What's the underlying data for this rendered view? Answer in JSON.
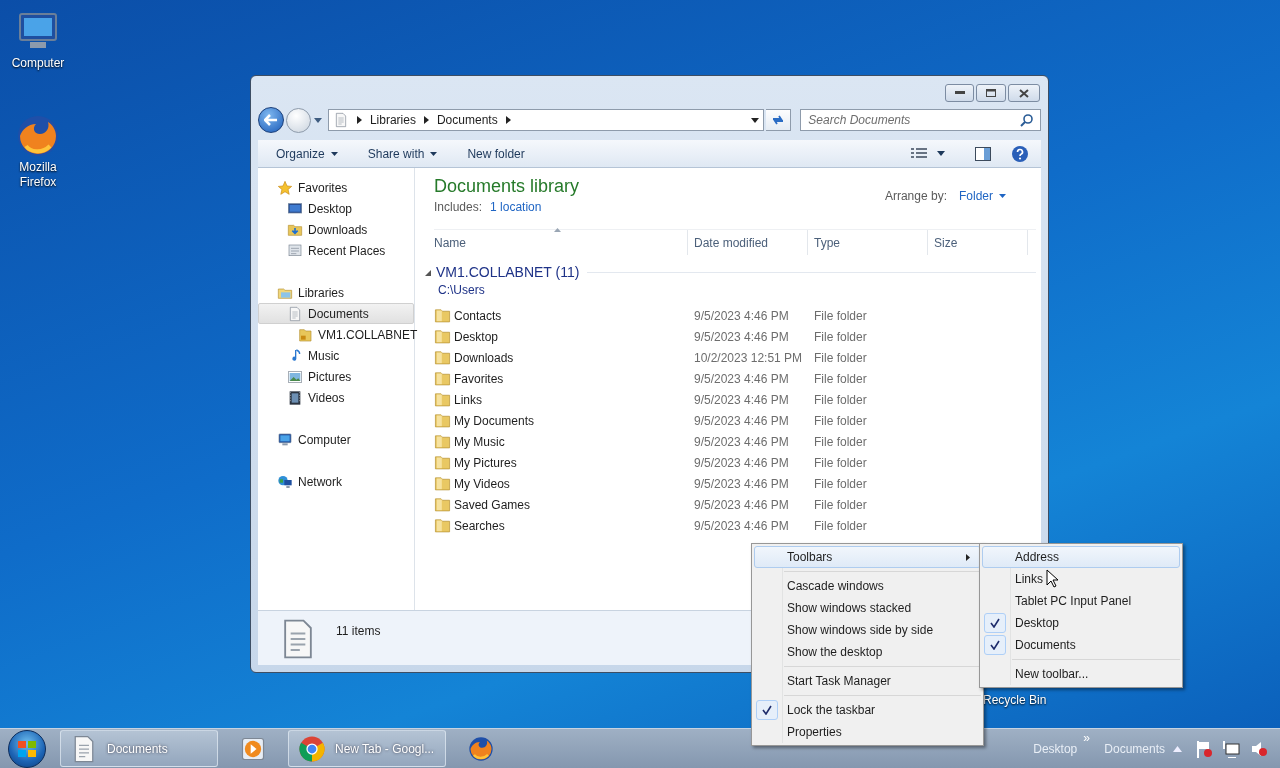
{
  "desktop": {
    "icons": [
      {
        "label": "Computer",
        "kind": "computer"
      },
      {
        "label": "Mozilla Firefox",
        "kind": "firefox"
      }
    ],
    "recycle_bin_label": "Recycle Bin"
  },
  "explorer": {
    "breadcrumb": [
      "Libraries",
      "Documents"
    ],
    "search": {
      "placeholder": "Search Documents"
    },
    "toolbar": [
      {
        "label": "Organize",
        "dropdown": true
      },
      {
        "label": "Share with",
        "dropdown": true
      },
      {
        "label": "New folder",
        "dropdown": false
      }
    ],
    "nav": [
      {
        "label": "Favorites",
        "kind": "star",
        "selected": false,
        "children": [
          {
            "label": "Desktop",
            "kind": "desktop",
            "selected": false
          },
          {
            "label": "Downloads",
            "kind": "downloads",
            "selected": false
          },
          {
            "label": "Recent Places",
            "kind": "recent",
            "selected": false
          }
        ]
      },
      {
        "label": "Libraries",
        "kind": "libraries",
        "selected": false,
        "children": [
          {
            "label": "Documents",
            "kind": "document",
            "selected": true,
            "children": [
              {
                "label": "VM1.COLLABNET",
                "kind": "lockfolder",
                "selected": false
              }
            ]
          },
          {
            "label": "Music",
            "kind": "music",
            "selected": false
          },
          {
            "label": "Pictures",
            "kind": "pictures",
            "selected": false
          },
          {
            "label": "Videos",
            "kind": "videos",
            "selected": false
          }
        ]
      },
      {
        "label": "Computer",
        "kind": "computer",
        "selected": false
      },
      {
        "label": "Network",
        "kind": "network",
        "selected": false
      }
    ],
    "library": {
      "title": "Documents library",
      "includes_label": "Includes:",
      "includes_link": "1 location",
      "arrange_label": "Arrange by:",
      "arrange_value": "Folder"
    },
    "columns": [
      "Name",
      "Date modified",
      "Type",
      "Size"
    ],
    "group": {
      "title": "VM1.COLLABNET (11)",
      "path": "C:\\Users",
      "expanded": true
    },
    "rows": [
      {
        "name": "Contacts",
        "date": "9/5/2023 4:46 PM",
        "type": "File folder"
      },
      {
        "name": "Desktop",
        "date": "9/5/2023 4:46 PM",
        "type": "File folder"
      },
      {
        "name": "Downloads",
        "date": "10/2/2023 12:51 PM",
        "type": "File folder"
      },
      {
        "name": "Favorites",
        "date": "9/5/2023 4:46 PM",
        "type": "File folder"
      },
      {
        "name": "Links",
        "date": "9/5/2023 4:46 PM",
        "type": "File folder"
      },
      {
        "name": "My Documents",
        "date": "9/5/2023 4:46 PM",
        "type": "File folder"
      },
      {
        "name": "My Music",
        "date": "9/5/2023 4:46 PM",
        "type": "File folder"
      },
      {
        "name": "My Pictures",
        "date": "9/5/2023 4:46 PM",
        "type": "File folder"
      },
      {
        "name": "My Videos",
        "date": "9/5/2023 4:46 PM",
        "type": "File folder"
      },
      {
        "name": "Saved Games",
        "date": "9/5/2023 4:46 PM",
        "type": "File folder"
      },
      {
        "name": "Searches",
        "date": "9/5/2023 4:46 PM",
        "type": "File folder"
      }
    ],
    "status": "11 items"
  },
  "context_menu": {
    "items": [
      {
        "kind": "item",
        "label": "Toolbars",
        "submenu": true,
        "highlighted": true,
        "checked": false
      },
      {
        "kind": "separator"
      },
      {
        "kind": "item",
        "label": "Cascade windows",
        "submenu": false,
        "highlighted": false,
        "checked": false
      },
      {
        "kind": "item",
        "label": "Show windows stacked",
        "submenu": false,
        "highlighted": false,
        "checked": false
      },
      {
        "kind": "item",
        "label": "Show windows side by side",
        "submenu": false,
        "highlighted": false,
        "checked": false
      },
      {
        "kind": "item",
        "label": "Show the desktop",
        "submenu": false,
        "highlighted": false,
        "checked": false
      },
      {
        "kind": "separator"
      },
      {
        "kind": "item",
        "label": "Start Task Manager",
        "submenu": false,
        "highlighted": false,
        "checked": false
      },
      {
        "kind": "separator"
      },
      {
        "kind": "item",
        "label": "Lock the taskbar",
        "submenu": false,
        "highlighted": false,
        "checked": true
      },
      {
        "kind": "item",
        "label": "Properties",
        "submenu": false,
        "highlighted": false,
        "checked": false
      }
    ]
  },
  "toolbars_submenu": {
    "items": [
      {
        "kind": "item",
        "label": "Address",
        "submenu": false,
        "highlighted": true,
        "checked": false
      },
      {
        "kind": "item",
        "label": "Links",
        "submenu": false,
        "highlighted": false,
        "checked": false
      },
      {
        "kind": "item",
        "label": "Tablet PC Input Panel",
        "submenu": false,
        "highlighted": false,
        "checked": false
      },
      {
        "kind": "item",
        "label": "Desktop",
        "submenu": false,
        "highlighted": false,
        "checked": true
      },
      {
        "kind": "item",
        "label": "Documents",
        "submenu": false,
        "highlighted": false,
        "checked": true
      },
      {
        "kind": "separator"
      },
      {
        "kind": "item",
        "label": "New toolbar...",
        "submenu": false,
        "highlighted": false,
        "checked": false
      }
    ]
  },
  "taskbar": {
    "buttons": [
      {
        "kind": "window",
        "label": "Documents"
      },
      {
        "kind": "pinned"
      },
      {
        "kind": "window",
        "label": "New Tab - Googl..."
      },
      {
        "kind": "pinned"
      }
    ],
    "toolbars": [
      "Desktop",
      "Documents"
    ],
    "chevron": "»"
  }
}
